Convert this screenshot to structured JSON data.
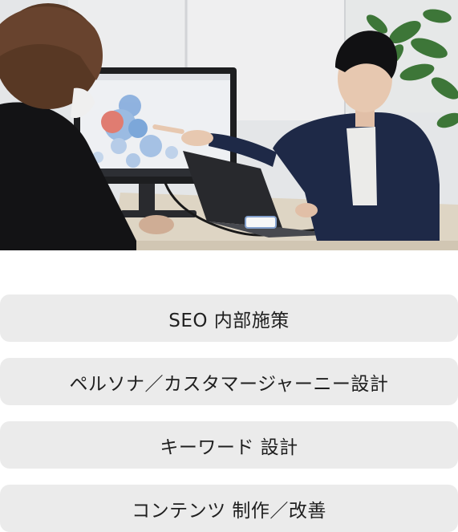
{
  "hero": {
    "image_label": "meeting-photo"
  },
  "services": {
    "items": [
      {
        "label": "SEO 内部施策"
      },
      {
        "label": "ペルソナ／カスタマージャーニー設計"
      },
      {
        "label": "キーワード 設計"
      },
      {
        "label": "コンテンツ 制作／改善"
      }
    ]
  },
  "colors": {
    "card_bg": "#ebebeb",
    "text": "#1f1f1f"
  }
}
